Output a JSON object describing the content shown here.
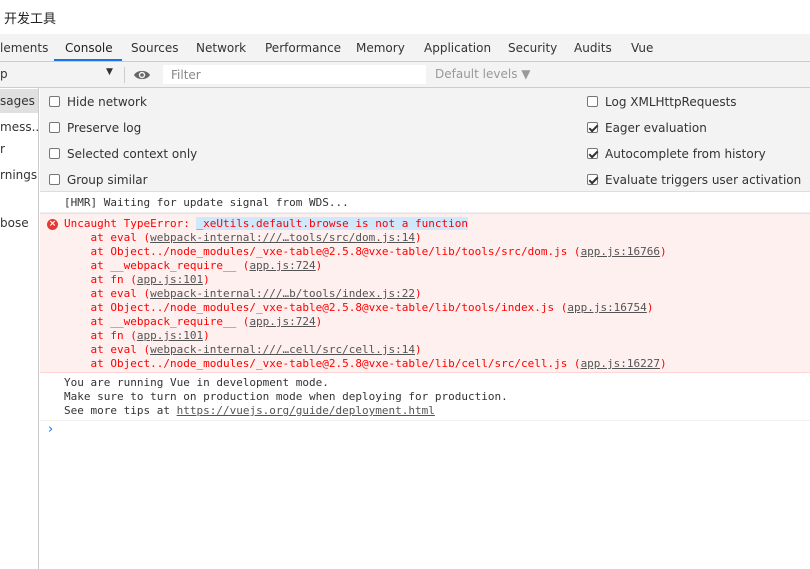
{
  "window": {
    "title": "开发工具"
  },
  "tabs": [
    {
      "label": "lements"
    },
    {
      "label": "Console"
    },
    {
      "label": "Sources"
    },
    {
      "label": "Network"
    },
    {
      "label": "Performance"
    },
    {
      "label": "Memory"
    },
    {
      "label": "Application"
    },
    {
      "label": "Security"
    },
    {
      "label": "Audits"
    },
    {
      "label": "Vue"
    }
  ],
  "toolbar": {
    "context_value": "p",
    "filter_placeholder": "Filter",
    "levels_label": "Default levels ▼"
  },
  "sidebar": {
    "items": [
      {
        "label": "sages"
      },
      {
        "label": "mess..."
      },
      {
        "label": "r"
      },
      {
        "label": "rnings"
      },
      {
        "label": "bose"
      }
    ]
  },
  "settings": {
    "left": [
      {
        "label": "Hide network",
        "checked": false
      },
      {
        "label": "Preserve log",
        "checked": false
      },
      {
        "label": "Selected context only",
        "checked": false
      },
      {
        "label": "Group similar",
        "checked": false
      }
    ],
    "right": [
      {
        "label": "Log XMLHttpRequests",
        "checked": false
      },
      {
        "label": "Eager evaluation",
        "checked": true
      },
      {
        "label": "Autocomplete from history",
        "checked": true
      },
      {
        "label": "Evaluate triggers user activation",
        "checked": true
      }
    ]
  },
  "console": {
    "hmr": "[HMR] Waiting for update signal from WDS...",
    "error": {
      "prefix": "Uncaught TypeError: ",
      "message": "_xeUtils.default.browse is not a function",
      "stack": [
        {
          "pre": "    at eval (",
          "link": "webpack-internal:///…tools/src/dom.js:14",
          "post": ")"
        },
        {
          "pre": "    at Object../node_modules/_vxe-table@2.5.8@vxe-table/lib/tools/src/dom.js (",
          "link": "app.js:16766",
          "post": ")"
        },
        {
          "pre": "    at __webpack_require__ (",
          "link": "app.js:724",
          "post": ")"
        },
        {
          "pre": "    at fn (",
          "link": "app.js:101",
          "post": ")"
        },
        {
          "pre": "    at eval (",
          "link": "webpack-internal:///…b/tools/index.js:22",
          "post": ")"
        },
        {
          "pre": "    at Object../node_modules/_vxe-table@2.5.8@vxe-table/lib/tools/index.js (",
          "link": "app.js:16754",
          "post": ")"
        },
        {
          "pre": "    at __webpack_require__ (",
          "link": "app.js:724",
          "post": ")"
        },
        {
          "pre": "    at fn (",
          "link": "app.js:101",
          "post": ")"
        },
        {
          "pre": "    at eval (",
          "link": "webpack-internal:///…cell/src/cell.js:14",
          "post": ")"
        },
        {
          "pre": "    at Object../node_modules/_vxe-table@2.5.8@vxe-table/lib/cell/src/cell.js (",
          "link": "app.js:16227",
          "post": ")"
        }
      ]
    },
    "vue": {
      "line1": "You are running Vue in development mode.",
      "line2": "Make sure to turn on production mode when deploying for production.",
      "line3_prefix": "See more tips at ",
      "line3_link": "https://vuejs.org/guide/deployment.html"
    },
    "prompt": "›"
  }
}
